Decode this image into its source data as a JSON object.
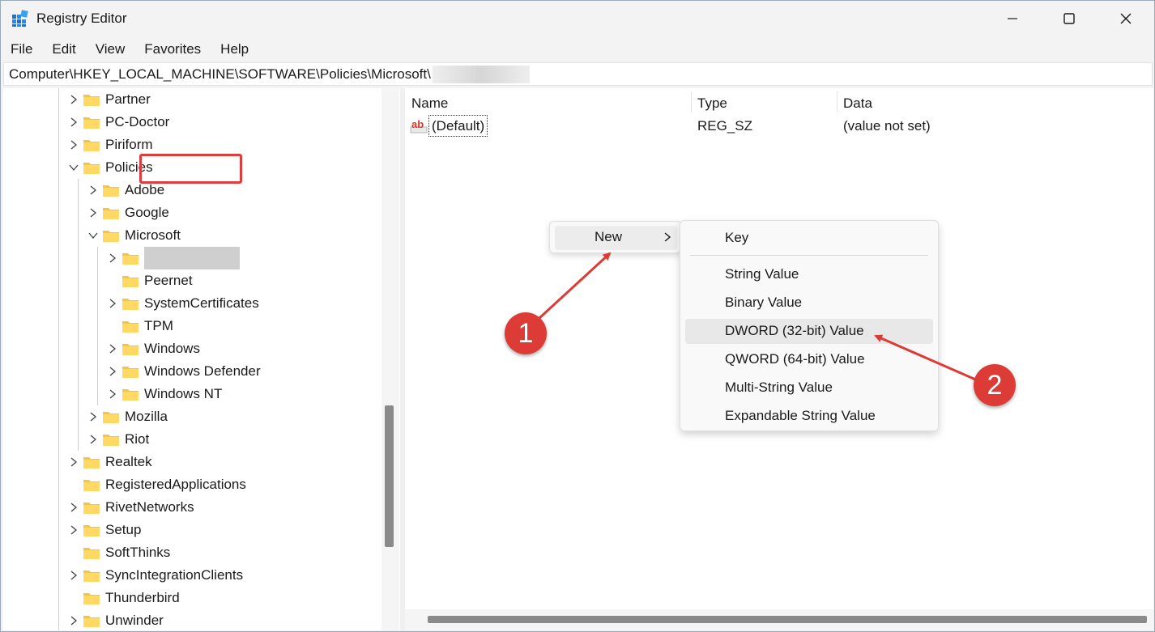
{
  "window": {
    "title": "Registry Editor",
    "controls": [
      "minimize",
      "maximize",
      "close"
    ]
  },
  "menu": [
    "File",
    "Edit",
    "View",
    "Favorites",
    "Help"
  ],
  "address": {
    "path": "Computer\\HKEY_LOCAL_MACHINE\\SOFTWARE\\Policies\\Microsoft\\"
  },
  "tree": {
    "items": [
      {
        "label": "Partner",
        "expander": "collapsed"
      },
      {
        "label": "PC-Doctor",
        "expander": "collapsed"
      },
      {
        "label": "Piriform",
        "expander": "collapsed"
      },
      {
        "label": "Policies",
        "expander": "expanded"
      },
      {
        "label": "Adobe",
        "expander": "collapsed"
      },
      {
        "label": "Google",
        "expander": "collapsed"
      },
      {
        "label": "Microsoft",
        "expander": "expanded"
      },
      {
        "label": "",
        "expander": "collapsed",
        "redacted": true
      },
      {
        "label": "Peernet",
        "expander": "none"
      },
      {
        "label": "SystemCertificates",
        "expander": "collapsed"
      },
      {
        "label": "TPM",
        "expander": "none"
      },
      {
        "label": "Windows",
        "expander": "collapsed"
      },
      {
        "label": "Windows Defender",
        "expander": "collapsed"
      },
      {
        "label": "Windows NT",
        "expander": "collapsed"
      },
      {
        "label": "Mozilla",
        "expander": "collapsed"
      },
      {
        "label": "Riot",
        "expander": "collapsed"
      },
      {
        "label": "Realtek",
        "expander": "collapsed"
      },
      {
        "label": "RegisteredApplications",
        "expander": "none"
      },
      {
        "label": "RivetNetworks",
        "expander": "collapsed"
      },
      {
        "label": "Setup",
        "expander": "collapsed"
      },
      {
        "label": "SoftThinks",
        "expander": "none"
      },
      {
        "label": "SyncIntegrationClients",
        "expander": "collapsed"
      },
      {
        "label": "Thunderbird",
        "expander": "none"
      },
      {
        "label": "Unwinder",
        "expander": "collapsed"
      }
    ]
  },
  "values": {
    "columns": {
      "name": "Name",
      "type": "Type",
      "data": "Data"
    },
    "rows": [
      {
        "name": "(Default)",
        "type": "REG_SZ",
        "data": "(value not set)"
      }
    ]
  },
  "context_menu": {
    "new_label": "New",
    "submenu": [
      "Key",
      "String Value",
      "Binary Value",
      "DWORD (32-bit) Value",
      "QWORD (64-bit) Value",
      "Multi-String Value",
      "Expandable String Value"
    ],
    "hovered": "DWORD (32-bit) Value"
  },
  "annotations": {
    "step1": "1",
    "step2": "2",
    "color": "#dd3b35"
  }
}
